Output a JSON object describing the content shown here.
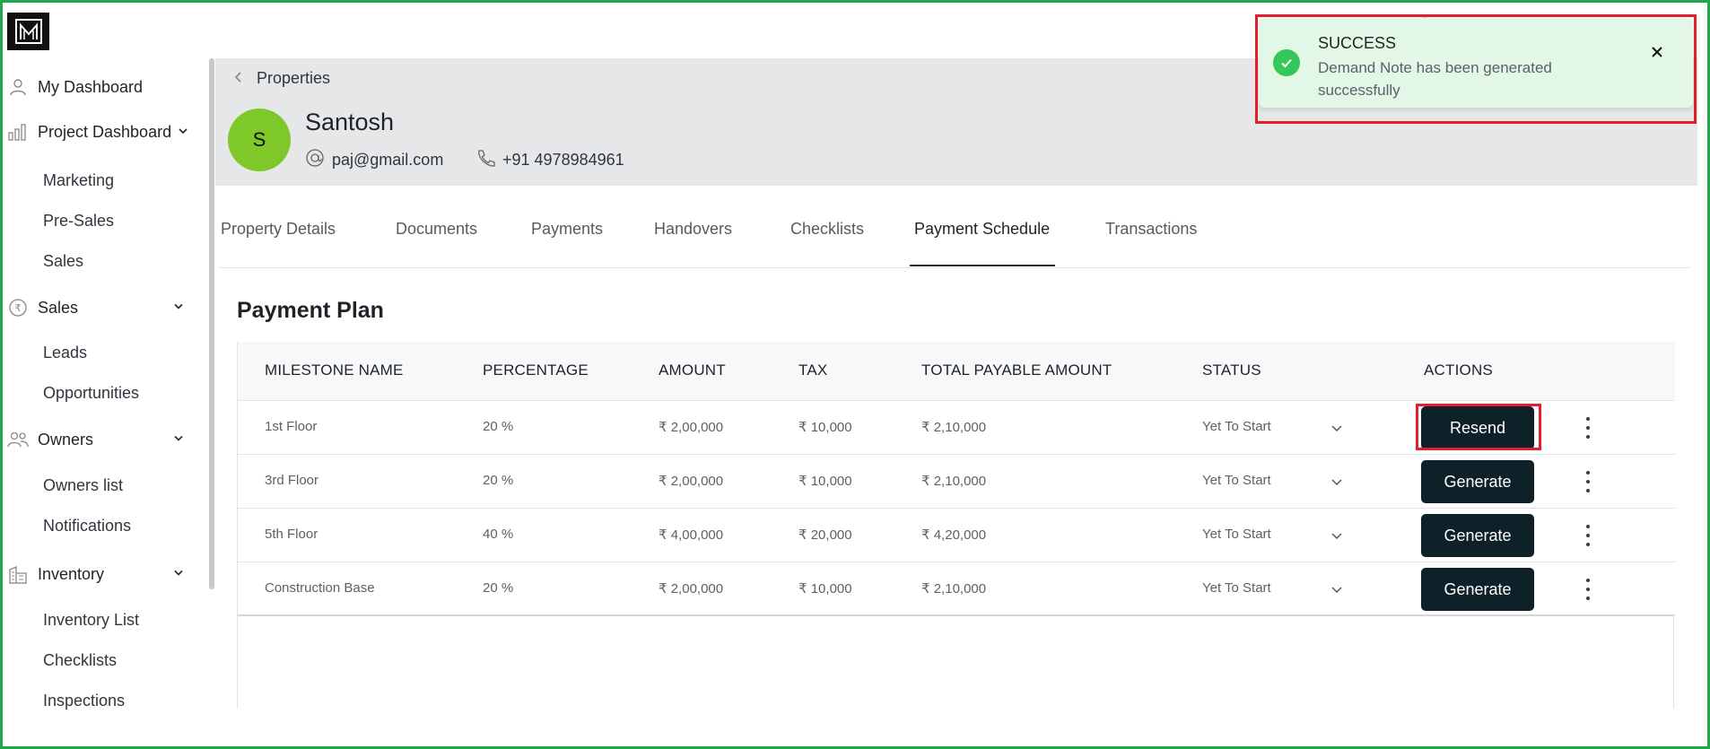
{
  "sidebar": {
    "items": [
      {
        "label": "My Dashboard",
        "icon": "user-icon"
      },
      {
        "label": "Project Dashboard",
        "icon": "bar-chart-icon"
      },
      {
        "label": "Marketing"
      },
      {
        "label": "Pre-Sales"
      },
      {
        "label": "Sales"
      },
      {
        "label": "Sales",
        "icon": "rupee-icon"
      },
      {
        "label": "Leads"
      },
      {
        "label": "Opportunities"
      },
      {
        "label": "Owners",
        "icon": "users-icon"
      },
      {
        "label": "Owners list"
      },
      {
        "label": "Notifications"
      },
      {
        "label": "Inventory",
        "icon": "building-icon"
      },
      {
        "label": "Inventory List"
      },
      {
        "label": "Checklists"
      },
      {
        "label": "Inspections"
      }
    ]
  },
  "breadcrumb": {
    "label": "Properties"
  },
  "owner": {
    "initial": "S",
    "name": "Santosh",
    "email": "paj@gmail.com",
    "phone": "+91 4978984961"
  },
  "tabs": [
    {
      "label": "Property Details"
    },
    {
      "label": "Documents"
    },
    {
      "label": "Payments"
    },
    {
      "label": "Handovers"
    },
    {
      "label": "Checklists"
    },
    {
      "label": "Payment Schedule",
      "active": true
    },
    {
      "label": "Transactions"
    }
  ],
  "payment_plan": {
    "title": "Payment Plan",
    "columns": [
      "MILESTONE NAME",
      "PERCENTAGE",
      "AMOUNT",
      "TAX",
      "TOTAL PAYABLE AMOUNT",
      "STATUS",
      "ACTIONS"
    ],
    "rows": [
      {
        "milestone": "1st Floor",
        "percentage": "20 %",
        "amount": "₹ 2,00,000",
        "tax": "₹ 10,000",
        "total": "₹ 2,10,000",
        "status": "Yet To Start",
        "action": "Resend"
      },
      {
        "milestone": "3rd Floor",
        "percentage": "20 %",
        "amount": "₹ 2,00,000",
        "tax": "₹ 10,000",
        "total": "₹ 2,10,000",
        "status": "Yet To Start",
        "action": "Generate"
      },
      {
        "milestone": "5th Floor",
        "percentage": "40 %",
        "amount": "₹ 4,00,000",
        "tax": "₹ 20,000",
        "total": "₹ 4,20,000",
        "status": "Yet To Start",
        "action": "Generate"
      },
      {
        "milestone": "Construction Base",
        "percentage": "20 %",
        "amount": "₹ 2,00,000",
        "tax": "₹ 10,000",
        "total": "₹ 2,10,000",
        "status": "Yet To Start",
        "action": "Generate"
      }
    ]
  },
  "toast": {
    "title": "SUCCESS",
    "message": "Demand Note has been generated successfully"
  },
  "colors": {
    "frame": "#22a84a",
    "highlight": "#e0202c",
    "avatar": "#7fc82a",
    "button": "#0f2128",
    "toast_bg": "#e3f7e6",
    "success": "#34c759"
  }
}
